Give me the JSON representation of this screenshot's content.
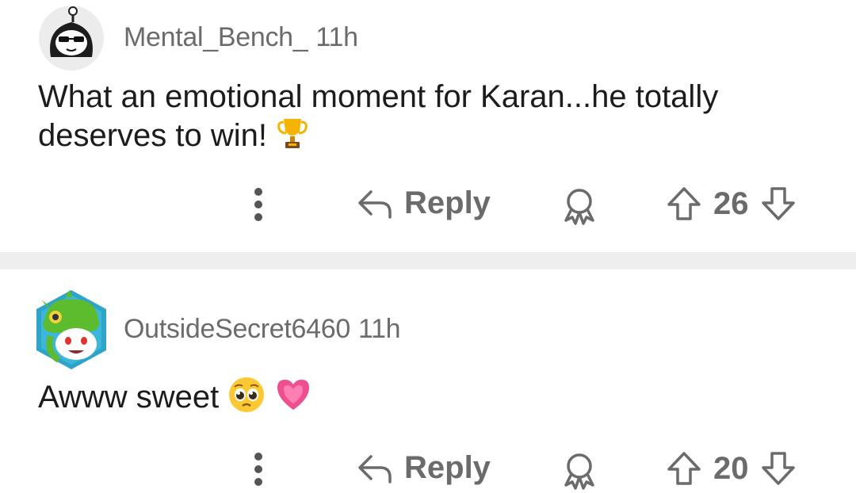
{
  "comments": [
    {
      "author": "Mental_Bench_",
      "time": "11h",
      "text": "What an emotional moment for Karan...he totally deserves to win!",
      "emoji": "trophy-icon",
      "reply_label": "Reply",
      "score": "26"
    },
    {
      "author": "OutsideSecret6460",
      "time": "11h",
      "text": "Awww sweet",
      "emoji": "pleading-face-and-heart-icons",
      "reply_label": "Reply",
      "score": "20"
    }
  ],
  "colors": {
    "text": "#1c1c1c",
    "meta": "#6b6b6b",
    "divider": "#eeeeee"
  }
}
